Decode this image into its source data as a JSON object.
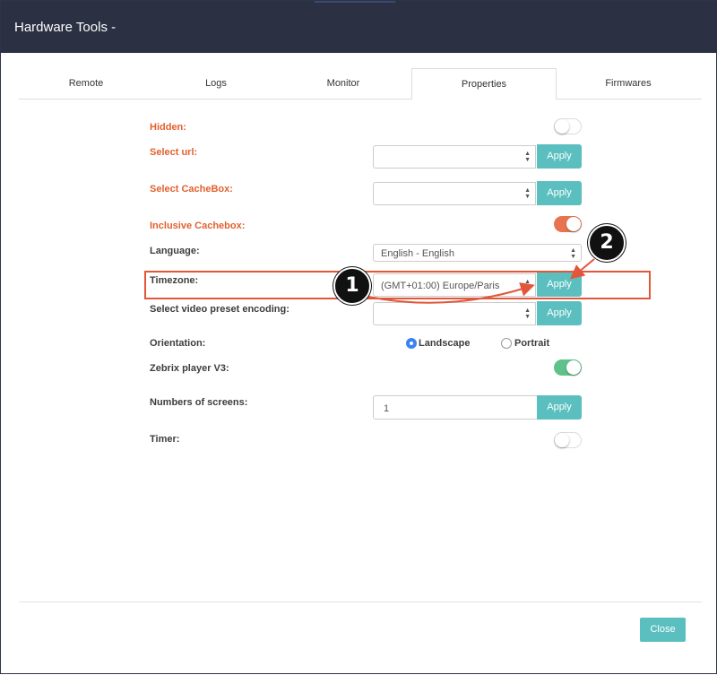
{
  "window": {
    "title": "Hardware Tools -"
  },
  "tabs": [
    {
      "label": "Remote",
      "active": false
    },
    {
      "label": "Logs",
      "active": false
    },
    {
      "label": "Monitor",
      "active": false
    },
    {
      "label": "Properties",
      "active": true
    },
    {
      "label": "Firmwares",
      "active": false
    }
  ],
  "properties": {
    "hidden": {
      "label": "Hidden:",
      "state": "off"
    },
    "select_url": {
      "label": "Select url:",
      "value": "",
      "apply": "Apply"
    },
    "select_cachebox": {
      "label": "Select CacheBox:",
      "value": "",
      "apply": "Apply"
    },
    "inclusive_cachebox": {
      "label": "Inclusive Cachebox:",
      "state": "on"
    },
    "language": {
      "label": "Language:",
      "value": "English - English"
    },
    "timezone": {
      "label": "Timezone:",
      "value": "(GMT+01:00) Europe/Paris",
      "apply": "Apply"
    },
    "video_preset": {
      "label": "Select video preset encoding:",
      "value": "",
      "apply": "Apply"
    },
    "orientation": {
      "label": "Orientation:",
      "options": [
        "Landscape",
        "Portrait"
      ],
      "selected": "Landscape"
    },
    "zebrix_player": {
      "label": "Zebrix player V3:",
      "state": "on"
    },
    "numbers_of_screens": {
      "label": "Numbers of screens:",
      "value": "1",
      "apply": "Apply"
    },
    "timer": {
      "label": "Timer:",
      "state": "off"
    }
  },
  "annotations": {
    "step1": "1",
    "step2": "2"
  },
  "footer": {
    "close": "Close"
  },
  "colors": {
    "titlebar": "#2b3142",
    "accent": "#5bbfbf",
    "label_orange": "#e2612f",
    "toggle_orange": "#e8744f",
    "toggle_green": "#5fc28a",
    "highlight": "#e2573a"
  }
}
